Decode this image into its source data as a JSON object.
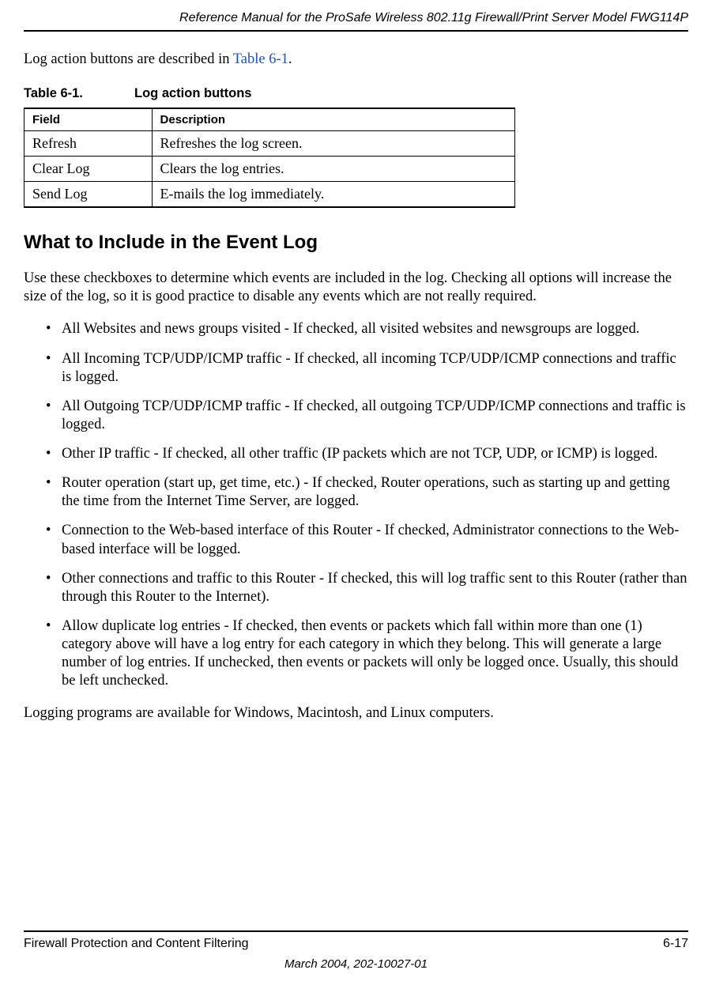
{
  "header": {
    "title": "Reference Manual for the ProSafe Wireless 802.11g  Firewall/Print Server Model FWG114P"
  },
  "intro": {
    "text_before_ref": "Log action buttons are described in ",
    "table_ref": "Table 6-1",
    "text_after_ref": "."
  },
  "table": {
    "caption_number": "Table 6-1.",
    "caption_title": "Log action buttons",
    "headers": {
      "field": "Field",
      "description": "Description"
    },
    "rows": [
      {
        "field": "Refresh",
        "description": "Refreshes the log screen."
      },
      {
        "field": "Clear Log",
        "description": "Clears the log entries."
      },
      {
        "field": "Send Log",
        "description": "E-mails the log immediately."
      }
    ]
  },
  "section": {
    "heading": "What to Include in the Event Log",
    "intro": "Use these checkboxes to determine which events are included in the log. Checking all options will increase the size of the log, so it is good practice to disable any events which are not really required.",
    "items": [
      "All Websites and news groups visited - If checked, all visited websites and newsgroups are logged.",
      "All Incoming TCP/UDP/ICMP traffic - If checked, all incoming TCP/UDP/ICMP connections and traffic is logged.",
      "All Outgoing TCP/UDP/ICMP traffic - If checked, all outgoing TCP/UDP/ICMP connections and traffic is logged.",
      "Other IP traffic - If checked, all other traffic (IP packets which are not TCP, UDP, or ICMP) is logged.",
      "Router operation (start up, get time, etc.) - If checked, Router operations, such as starting up and getting the time from the Internet Time Server, are logged.",
      "Connection to the Web-based interface of this Router - If checked, Administrator connections to the Web-based interface will be logged.",
      "Other connections and traffic to this Router - If checked, this will log traffic sent to this Router (rather than through this Router to the Internet).",
      "Allow duplicate log entries - If checked, then events or packets which fall within more than one (1) category above will have a log entry for each category in which they belong. This will generate a large number of log entries. If unchecked, then events or packets will only be logged once. Usually, this should be left unchecked."
    ],
    "closing": "Logging programs are available for Windows, Macintosh, and Linux computers."
  },
  "footer": {
    "left": "Firewall Protection and Content Filtering",
    "right": "6-17",
    "date": "March 2004, 202-10027-01"
  }
}
